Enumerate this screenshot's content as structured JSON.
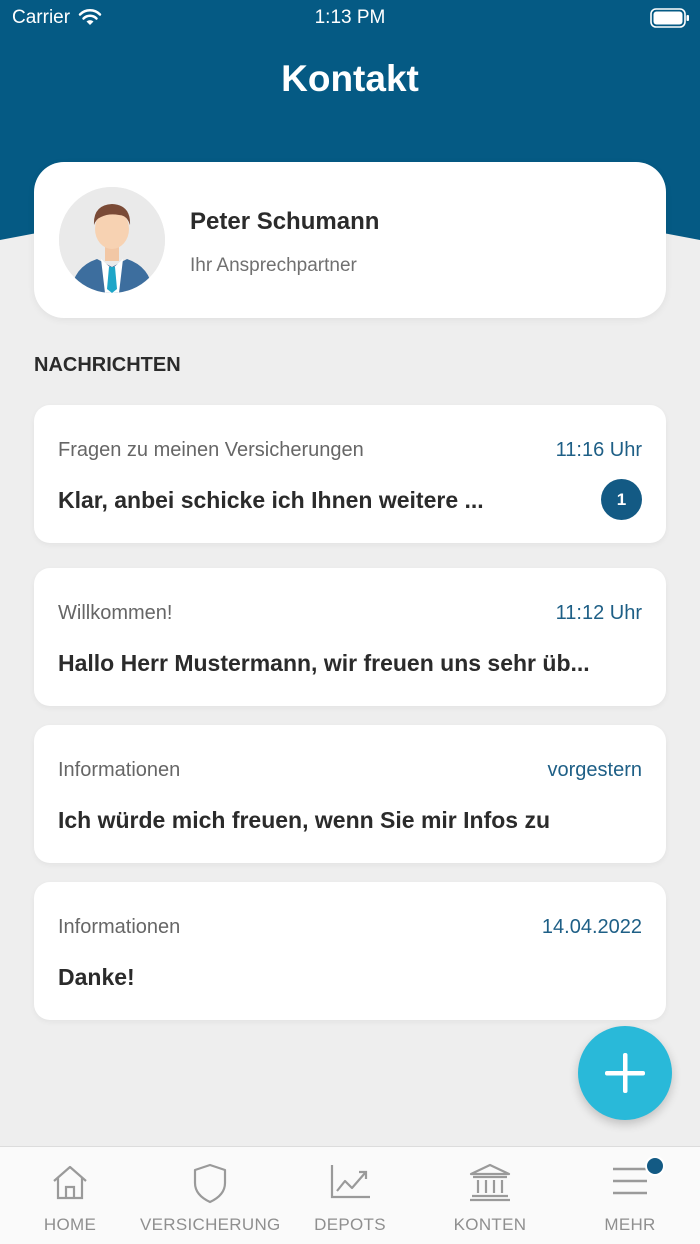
{
  "status_bar": {
    "carrier": "Carrier",
    "time": "1:13 PM"
  },
  "header": {
    "title": "Kontakt",
    "color": "#055a84"
  },
  "contact": {
    "name": "Peter Schumann",
    "role": "Ihr Ansprechpartner"
  },
  "messages_section": {
    "title": "NACHRICHTEN",
    "items": [
      {
        "subject": "Fragen zu meinen Versicherungen",
        "time": "11:16 Uhr",
        "preview": "Klar, anbei schicke ich Ihnen weitere ...",
        "badge": "1"
      },
      {
        "subject": "Willkommen!",
        "time": "11:12 Uhr",
        "preview": "Hallo Herr Mustermann, wir freuen uns sehr üb..."
      },
      {
        "subject": "Informationen",
        "time": "vorgestern",
        "preview": "Ich würde mich freuen, wenn Sie mir Infos zu"
      },
      {
        "subject": "Informationen",
        "time": "14.04.2022",
        "preview": "Danke!"
      }
    ]
  },
  "fab": {
    "icon": "plus-icon",
    "color": "#29b9d9"
  },
  "tabbar": {
    "tabs": [
      {
        "label": "HOME",
        "icon": "home-icon"
      },
      {
        "label": "VERSICHERUNG",
        "icon": "shield-icon"
      },
      {
        "label": "DEPOTS",
        "icon": "chart-icon"
      },
      {
        "label": "KONTEN",
        "icon": "bank-icon"
      },
      {
        "label": "MEHR",
        "icon": "menu-icon"
      }
    ]
  }
}
